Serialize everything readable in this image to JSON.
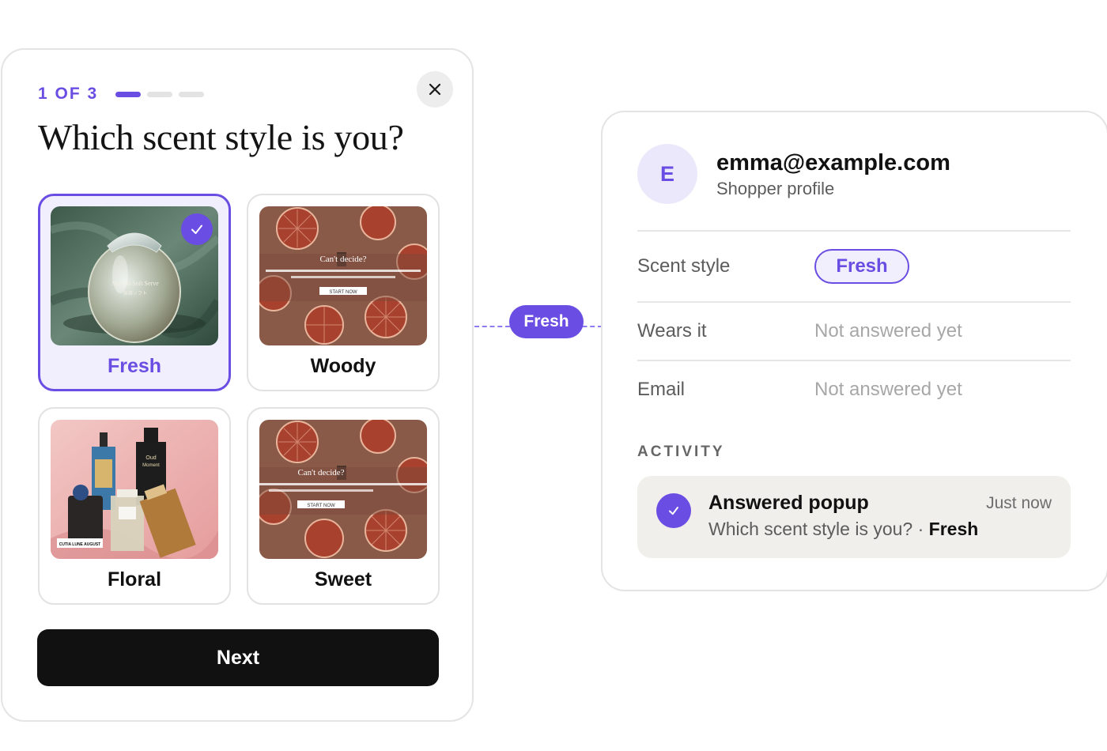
{
  "popup": {
    "step_label": "1 OF 3",
    "question": "Which scent style is you?",
    "options": [
      {
        "label": "Fresh",
        "selected": true,
        "image": "perfume-egg-bottle-photo",
        "image_text": [
          "Matcha Soft Serve",
          "抹茶ソフト"
        ]
      },
      {
        "label": "Woody",
        "selected": false,
        "image": "blood-orange-banner-photo",
        "image_text": [
          "Can't decide?",
          "START NOW"
        ]
      },
      {
        "label": "Floral",
        "selected": false,
        "image": "perfume-bottles-group-photo",
        "image_text": [
          "Oud Moment",
          "CUTIA LUNE AUGUST"
        ]
      },
      {
        "label": "Sweet",
        "selected": false,
        "image": "blood-orange-banner-photo",
        "image_text": [
          "Can't decide?",
          "START NOW"
        ]
      }
    ],
    "next_label": "Next",
    "close_icon": "close-icon",
    "check_icon": "check-icon"
  },
  "connector": {
    "label": "Fresh"
  },
  "profile": {
    "avatar_letter": "E",
    "email": "emma@example.com",
    "subtitle": "Shopper profile",
    "rows": [
      {
        "label": "Scent style",
        "value": "Fresh"
      },
      {
        "label": "Wears it",
        "value": "Not answered yet"
      },
      {
        "label": "Email",
        "value": "Not answered yet"
      }
    ],
    "activity_heading": "ACTIVITY",
    "activity": {
      "title": "Answered popup",
      "time": "Just now",
      "question": "Which scent style is you?",
      "separator": "·",
      "answer": "Fresh"
    }
  },
  "colors": {
    "accent": "#6a4de2",
    "accent_light": "#f1eefd",
    "button": "#111111",
    "activity_bg": "#f0efeb"
  }
}
